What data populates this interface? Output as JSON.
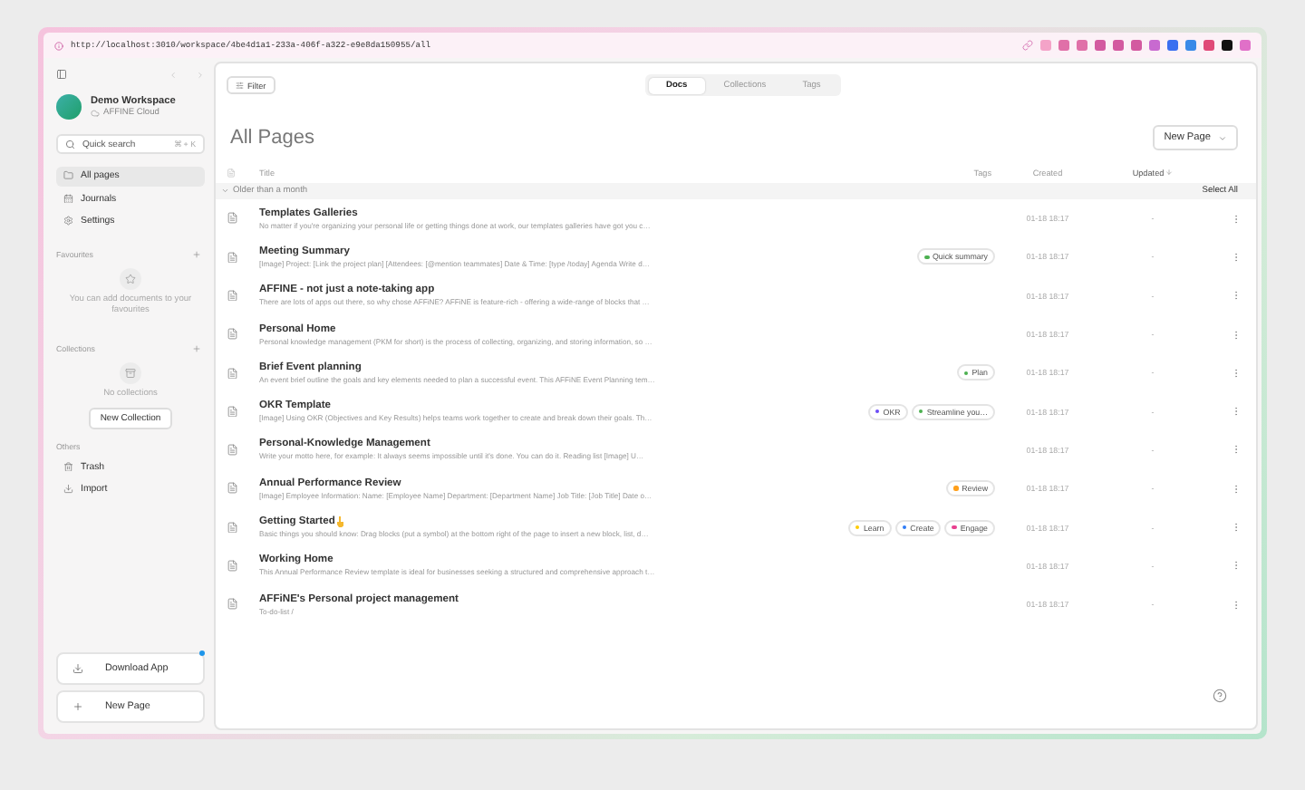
{
  "browser": {
    "url": "http://localhost:3010/workspace/4be4d1a1-233a-406f-a322-e9e8da150955/all"
  },
  "sidebar": {
    "workspace": {
      "name": "Demo Workspace",
      "subtitle": "AFFINE Cloud"
    },
    "search": {
      "placeholder": "Quick search",
      "shortcut": "⌘ + K"
    },
    "nav": [
      {
        "label": "All pages",
        "selected": true
      },
      {
        "label": "Journals",
        "selected": false
      },
      {
        "label": "Settings",
        "selected": false
      }
    ],
    "favourites": {
      "title": "Favourites",
      "empty_text": "You can add documents to your favourites"
    },
    "collections": {
      "title": "Collections",
      "empty_text": "No collections",
      "button": "New Collection"
    },
    "others": {
      "title": "Others",
      "items": [
        "Trash",
        "Import"
      ]
    },
    "download_app": {
      "label": "Download App",
      "notification": true
    },
    "new_page": "New Page"
  },
  "toolbar": {
    "filter": "Filter",
    "tabs": [
      {
        "label": "Docs",
        "selected": true
      },
      {
        "label": "Collections",
        "selected": false
      },
      {
        "label": "Tags",
        "selected": false
      }
    ]
  },
  "page": {
    "title": "All Pages",
    "new_page": "New Page"
  },
  "table": {
    "columns": {
      "title": "Title",
      "tags": "Tags",
      "created": "Created",
      "updated": "Updated"
    },
    "group": {
      "label": "Older than a month",
      "expanded": true,
      "select_all": "Select All"
    },
    "rows": [
      {
        "title": "Templates Galleries",
        "description": "No matter if you're organizing your personal life or getting things done at work, our templates galleries have got you c…",
        "tags": [],
        "created": "01-18 18:17",
        "updated": "-"
      },
      {
        "title": "Meeting Summary",
        "description": "[Image] Project: [Link the project plan] [Attendees: [@mention teammates] Date & Time: [type /today] Agenda Write d…",
        "tags": [
          {
            "label": "Quick summary",
            "color": "#4cb050"
          }
        ],
        "created": "01-18 18:17",
        "updated": "-"
      },
      {
        "title": "AFFINE - not just a note-taking app",
        "description": "There are lots of apps out there, so why chose AFFiNE? AFFiNE is feature-rich - offering a wide-range of blocks that …",
        "tags": [],
        "created": "01-18 18:17",
        "updated": "-"
      },
      {
        "title": "Personal Home",
        "description": "Personal knowledge management (PKM for short) is the process of collecting, organizing, and storing information, so …",
        "tags": [],
        "created": "01-18 18:17",
        "updated": "-"
      },
      {
        "title": "Brief Event planning",
        "description": "An event brief outline the goals and key elements needed to plan a successful event. This AFFiNE Event Planning tem…",
        "tags": [
          {
            "label": "Plan",
            "color": "#4cb050"
          }
        ],
        "created": "01-18 18:17",
        "updated": "-"
      },
      {
        "title": "OKR Template",
        "description": "[Image] Using OKR (Objectives and Key Results) helps teams work together to create and break down their goals. Th…",
        "tags": [
          {
            "label": "OKR",
            "color": "#6b4cf6"
          },
          {
            "label": "Streamline you…",
            "color": "#4cb050"
          }
        ],
        "created": "01-18 18:17",
        "updated": "-"
      },
      {
        "title": "Personal-Knowledge Management",
        "description": "Write your motto here, for example: It always seems impossible until it's done. You can do it. Reading list [Image] U…",
        "tags": [],
        "created": "01-18 18:17",
        "updated": "-"
      },
      {
        "title": "Annual Performance Review",
        "description": "[Image] Employee Information: Name: [Employee Name] Department: [Department Name] Job Title: [Job Title] Date o…",
        "tags": [
          {
            "label": "Review",
            "color": "#ff9f1a"
          }
        ],
        "created": "01-18 18:17",
        "updated": "-"
      },
      {
        "title": "Getting Started",
        "hand_icon": true,
        "description": "Basic things you should know: Drag blocks (put a symbol) at the bottom right of the page to insert a new block, list, d…",
        "tags": [
          {
            "label": "Learn",
            "color": "#ffcc00"
          },
          {
            "label": "Create",
            "color": "#2f7cf6"
          },
          {
            "label": "Engage",
            "color": "#e8408f"
          }
        ],
        "created": "01-18 18:17",
        "updated": "-"
      },
      {
        "title": "Working Home",
        "description": "This Annual Performance Review template is ideal for businesses seeking a structured and comprehensive approach t…",
        "tags": [],
        "created": "01-18 18:17",
        "updated": "-"
      },
      {
        "title": "AFFiNE's Personal project management",
        "description": "To-do-list /",
        "tags": [],
        "created": "01-18 18:17",
        "updated": "-"
      }
    ]
  }
}
